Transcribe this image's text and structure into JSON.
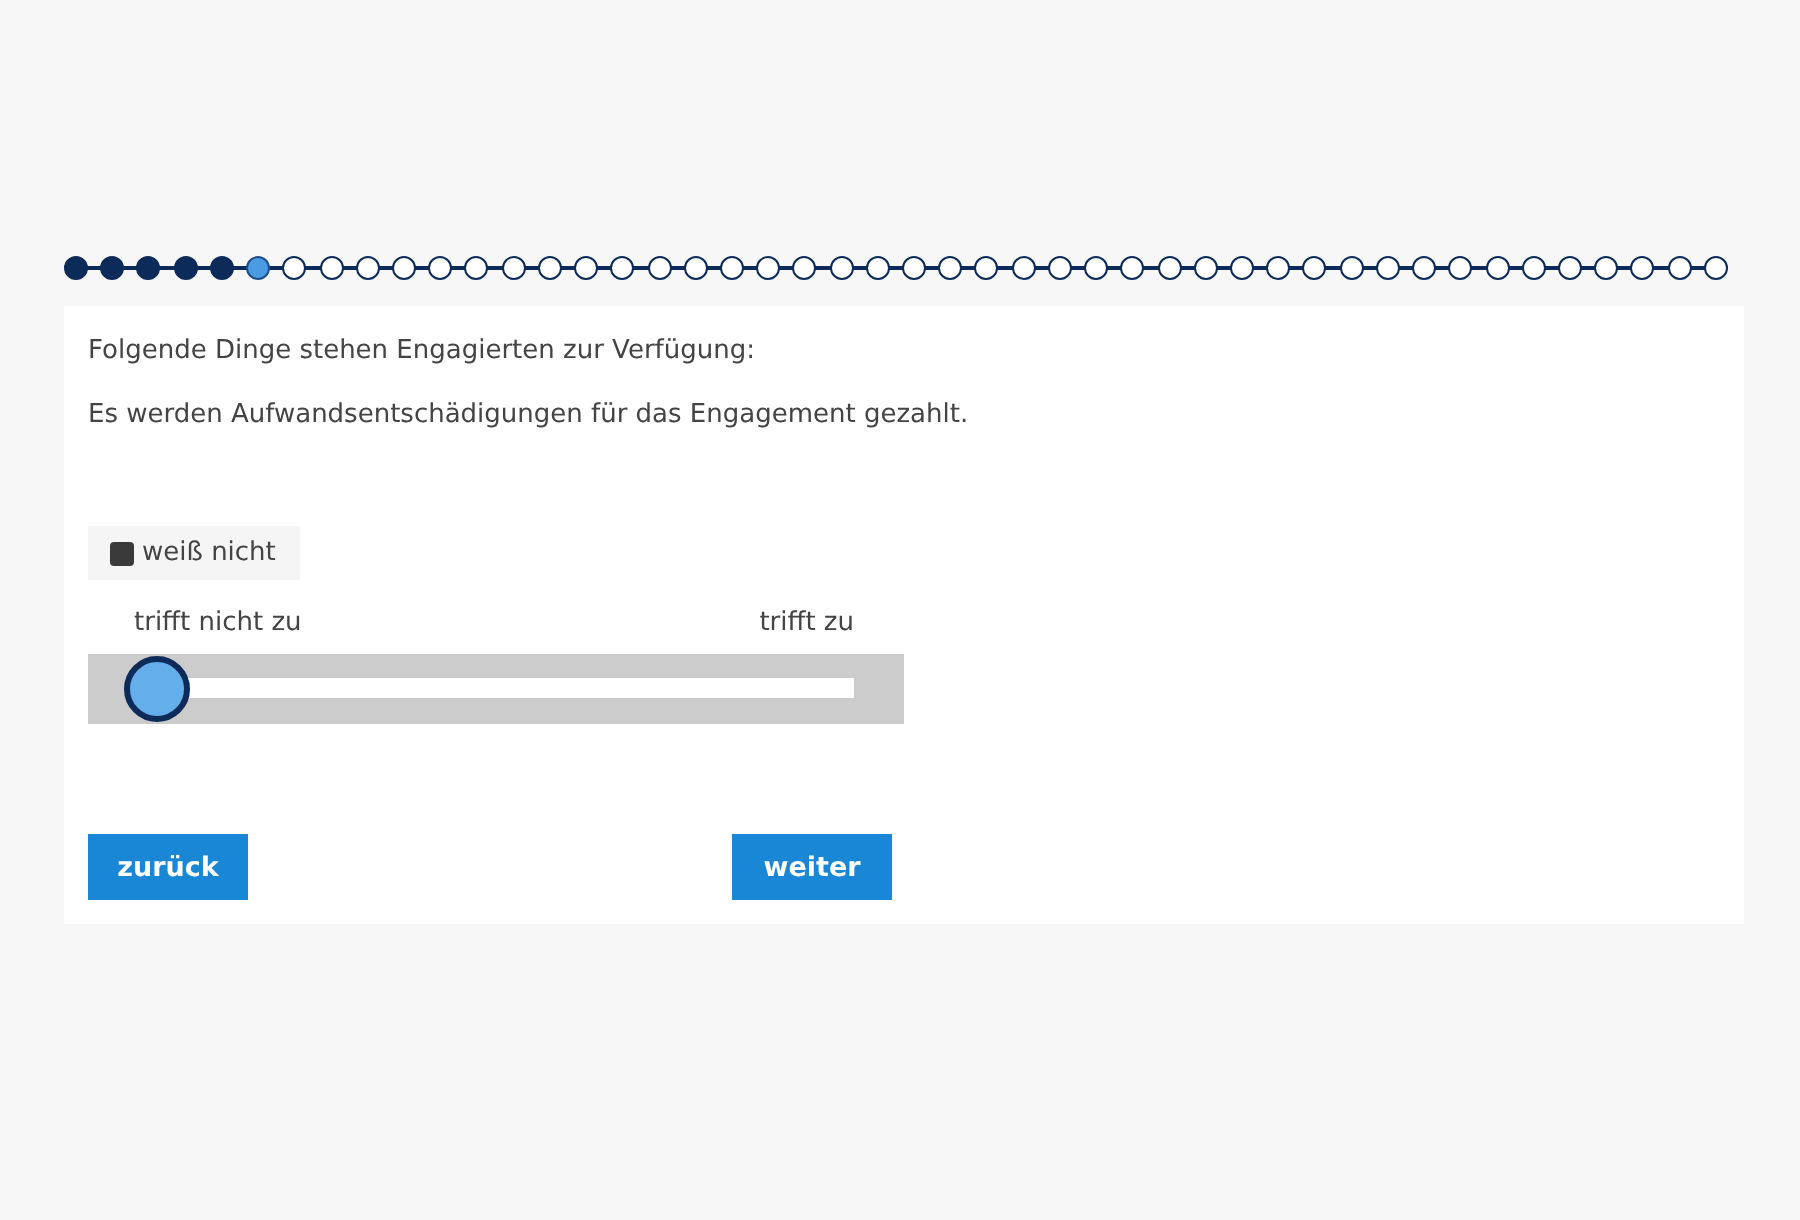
{
  "progress": {
    "steps": [
      {
        "done": true,
        "selected": false
      },
      {
        "done": true,
        "selected": false
      },
      {
        "done": true,
        "selected": false
      },
      {
        "done": true,
        "selected": false
      },
      {
        "done": true,
        "selected": false
      },
      {
        "done": false,
        "selected": true
      },
      {
        "done": false,
        "selected": false
      },
      {
        "done": false,
        "selected": false
      },
      {
        "done": false,
        "selected": false
      },
      {
        "done": false,
        "selected": false
      },
      {
        "done": false,
        "selected": false
      },
      {
        "done": false,
        "selected": false
      },
      {
        "done": false,
        "selected": false
      },
      {
        "done": false,
        "selected": false
      },
      {
        "done": false,
        "selected": false
      },
      {
        "done": false,
        "selected": false
      },
      {
        "done": false,
        "selected": false
      },
      {
        "done": false,
        "selected": false
      },
      {
        "done": false,
        "selected": false
      },
      {
        "done": false,
        "selected": false
      },
      {
        "done": false,
        "selected": false
      },
      {
        "done": false,
        "selected": false
      },
      {
        "done": false,
        "selected": false
      },
      {
        "done": false,
        "selected": false
      },
      {
        "done": false,
        "selected": false
      },
      {
        "done": false,
        "selected": false
      },
      {
        "done": false,
        "selected": false
      },
      {
        "done": false,
        "selected": false
      },
      {
        "done": false,
        "selected": false
      },
      {
        "done": false,
        "selected": false
      },
      {
        "done": false,
        "selected": false
      },
      {
        "done": false,
        "selected": false
      },
      {
        "done": false,
        "selected": false
      },
      {
        "done": false,
        "selected": false
      },
      {
        "done": false,
        "selected": false
      },
      {
        "done": false,
        "selected": false
      },
      {
        "done": false,
        "selected": false
      },
      {
        "done": false,
        "selected": false
      },
      {
        "done": false,
        "selected": false
      },
      {
        "done": false,
        "selected": false
      },
      {
        "done": false,
        "selected": false
      },
      {
        "done": false,
        "selected": false
      },
      {
        "done": false,
        "selected": false
      },
      {
        "done": false,
        "selected": false
      },
      {
        "done": false,
        "selected": false
      },
      {
        "done": false,
        "selected": false
      }
    ]
  },
  "question": {
    "intro": "Folgende Dinge stehen Engagierten zur Verfügung:",
    "statement": "Es werden Aufwandsentschädigungen für das Engagement gezahlt."
  },
  "dont_know": {
    "label": "weiß nicht",
    "checked": false
  },
  "slider": {
    "label_left": "trifft nicht zu",
    "label_right": "trifft zu",
    "level": 0
  },
  "buttons": {
    "back": "zurück",
    "next": "weiter"
  }
}
